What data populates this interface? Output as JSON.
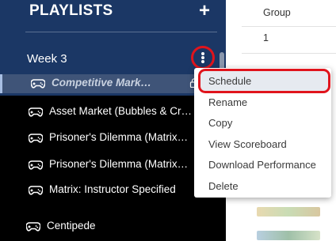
{
  "sidebar": {
    "title": "PLAYLISTS",
    "add_icon": "plus-icon",
    "week_label": "Week 3",
    "more_icon": "kebab-menu-icon",
    "items": [
      {
        "label": "Competitive Mark…",
        "icon": "gamepad-icon",
        "selected": true,
        "trailing_icon": "lock-icon"
      },
      {
        "label": "Asset Market (Bubbles & Cr…",
        "icon": "gamepad-icon"
      },
      {
        "label": "Prisoner's Dilemma (Matrix…",
        "icon": "gamepad-icon"
      },
      {
        "label": "Prisoner's Dilemma (Matrix…",
        "icon": "gamepad-icon"
      },
      {
        "label": "Matrix: Instructor Specified",
        "icon": "gamepad-icon"
      },
      {
        "label": "Centipede",
        "icon": "gamepad-icon"
      }
    ]
  },
  "content": {
    "column_header": "Group",
    "first_row_value": "1"
  },
  "context_menu": {
    "items": [
      {
        "label": "Schedule",
        "highlighted": true
      },
      {
        "label": "Rename"
      },
      {
        "label": "Copy"
      },
      {
        "label": "View Scoreboard"
      },
      {
        "label": "Download Performance"
      },
      {
        "label": "Delete"
      }
    ]
  },
  "colors": {
    "sidebar_header": "#1b3765",
    "sidebar_body": "#000000",
    "selected_row": "#3f5478",
    "highlight_ring": "#e0141c"
  }
}
